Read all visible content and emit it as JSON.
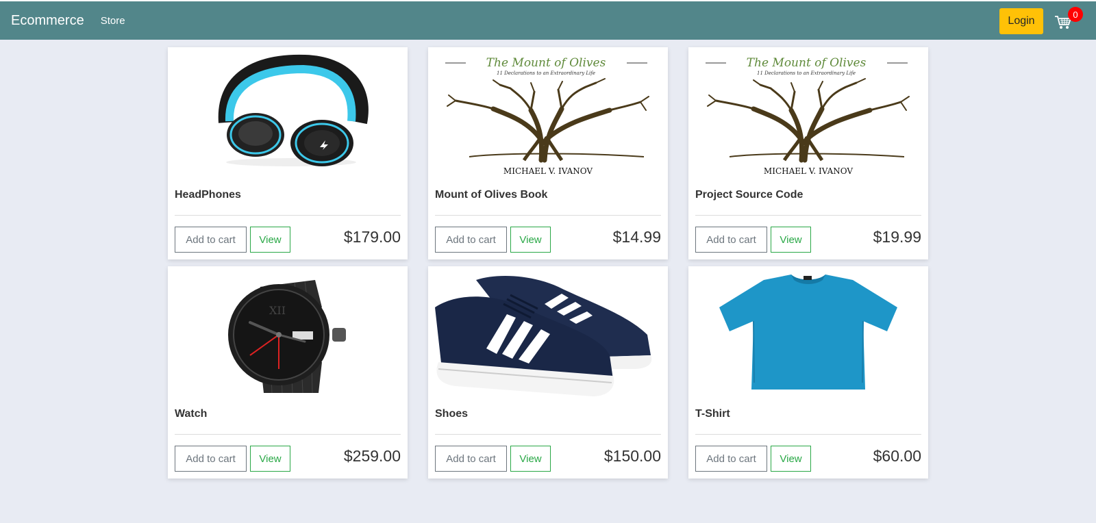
{
  "navbar": {
    "brand": "Ecommerce",
    "store_link": "Store",
    "login_label": "Login",
    "cart_count": "0",
    "bg_color": "#52868a",
    "login_color": "#ffc107",
    "badge_color": "#ff0000"
  },
  "card_labels": {
    "add_to_cart": "Add to cart",
    "view": "View"
  },
  "products": [
    {
      "title": "HeadPhones",
      "price": "$179.00",
      "image_icon": "headphones-image"
    },
    {
      "title": "Mount of Olives Book",
      "price": "$14.99",
      "image_icon": "book-cover-image"
    },
    {
      "title": "Project Source Code",
      "price": "$19.99",
      "image_icon": "book-cover-image"
    },
    {
      "title": "Watch",
      "price": "$259.00",
      "image_icon": "watch-image"
    },
    {
      "title": "Shoes",
      "price": "$150.00",
      "image_icon": "shoes-image"
    },
    {
      "title": "T-Shirt",
      "price": "$60.00",
      "image_icon": "tshirt-image"
    }
  ],
  "book_cover": {
    "title": "The Mount of Olives",
    "subtitle": "11 Declarations to an Extraordinary Life",
    "author": "MICHAEL V. IVANOV"
  }
}
